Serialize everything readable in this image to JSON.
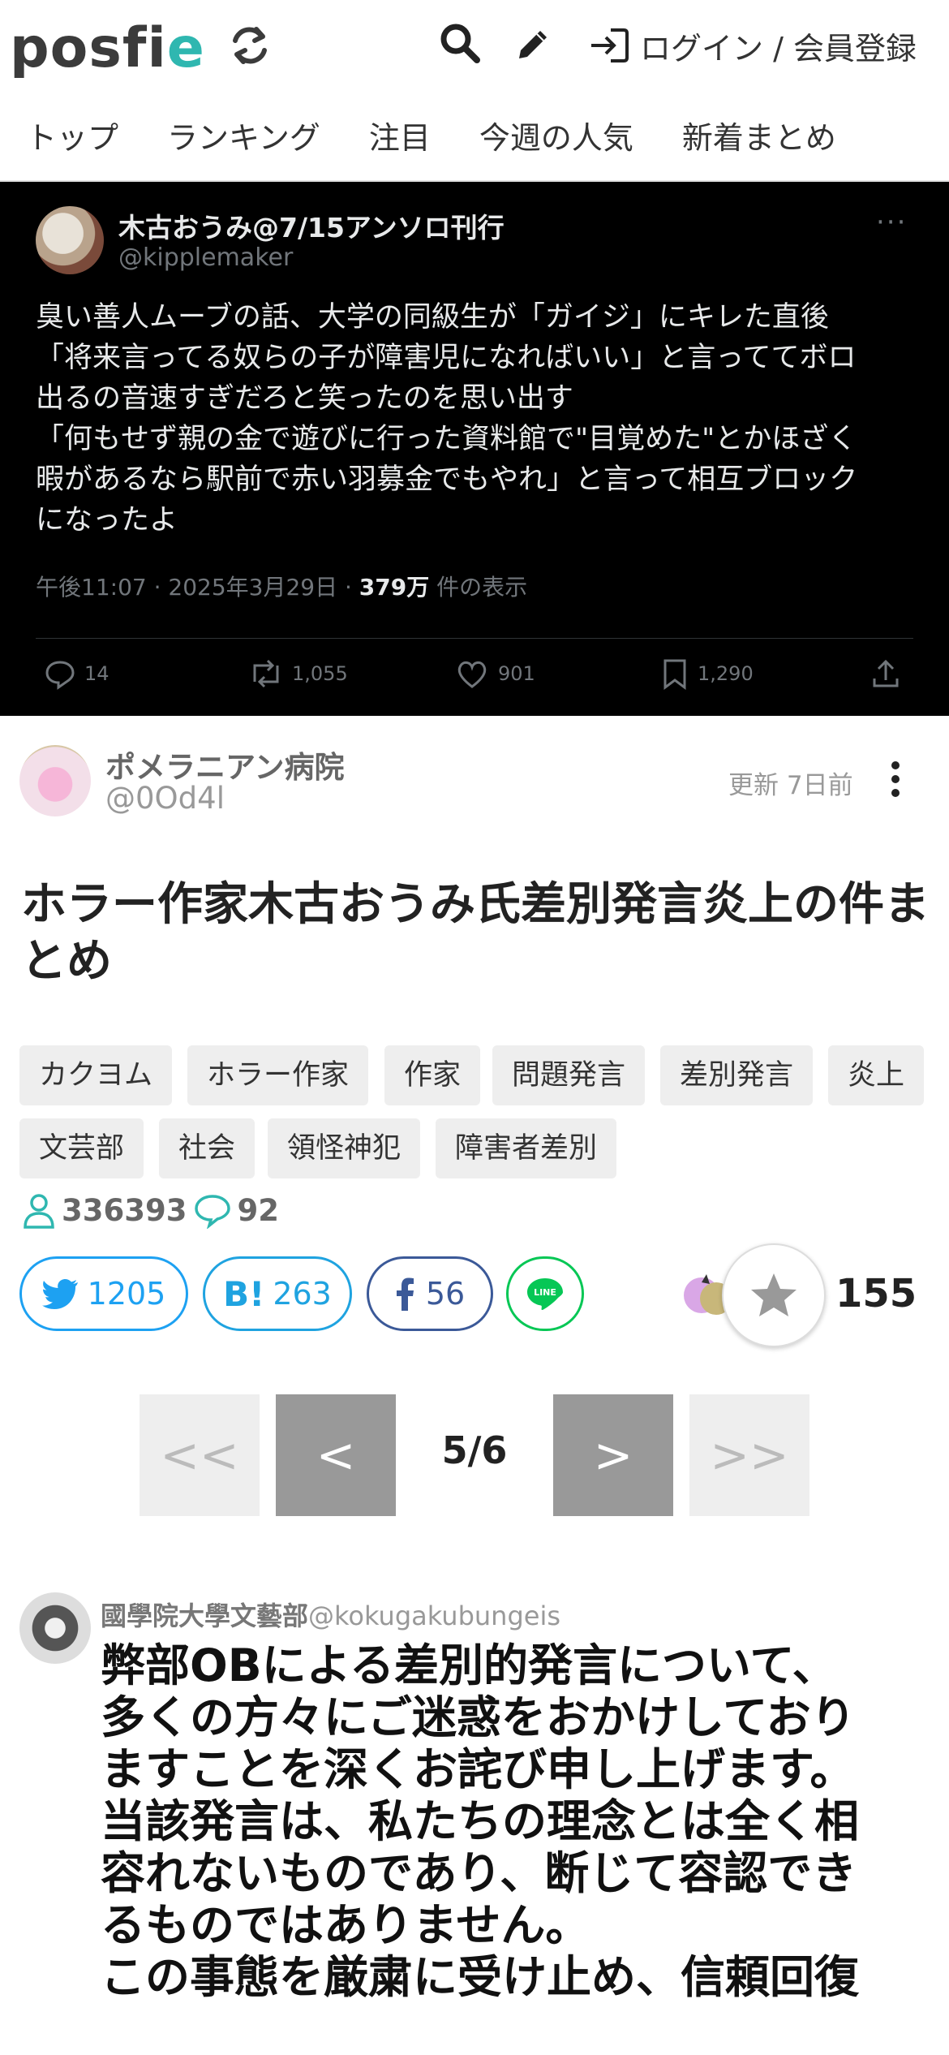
{
  "header": {
    "logo_main": "posfi",
    "logo_accent": "e",
    "login_label": "ログイン / 会員登録",
    "nav": [
      "トップ",
      "ランキング",
      "注目",
      "今週の人気",
      "新着まとめ"
    ]
  },
  "tweet": {
    "name": "木古おうみ@7/15アンソロ刊行",
    "handle": "@kipplemaker",
    "more": "···",
    "body": "臭い善人ムーブの話、大学の同級生が「ガイジ」にキレた直後\n「将来言ってる奴らの子が障害児になればいい」と言っててボロ\n出るの音速すぎだろと笑ったのを思い出す\n「何もせず親の金で遊びに行った資料館で\"目覚めた\"とかほざく\n暇があるなら駅前で赤い羽募金でもやれ」と言って相互ブロック\nになったよ",
    "time": "午後11:07 · 2025年3月29日 · ",
    "views": "379万",
    "views_suffix": " 件の表示",
    "replies": "14",
    "retweets": "1,055",
    "likes": "901",
    "bookmarks": "1,290"
  },
  "author": {
    "name": "ポメラニアン病院",
    "handle": "@0Od4l",
    "updated": "更新 7日前"
  },
  "title": "ホラー作家木古おうみ氏差別発言炎上の件まとめ",
  "tags": [
    "カクヨム",
    "ホラー作家",
    "作家",
    "問題発言",
    "差別発言",
    "炎上",
    "文芸部",
    "社会",
    "領怪神犯",
    "障害者差別"
  ],
  "stats": {
    "views": "336393",
    "comments": "92"
  },
  "share": {
    "twitter": "1205",
    "hatena": "263",
    "facebook": "56",
    "line": "LINE",
    "favorites": "155"
  },
  "pagination": {
    "label": "5/6",
    "first": "<<",
    "prev": "<",
    "next": ">",
    "last": ">>"
  },
  "item": {
    "source_name": "國學院大學文藝部",
    "source_handle": "@kokugakubungeis",
    "body": "弊部OBによる差別的発言について、\n多くの方々にご迷惑をおかけしており\nますことを深くお詫び申し上げます。\n当該発言は、私たちの理念とは全く相\n容れないものであり、断じて容認でき\nるものではありません。\nこの事態を厳粛に受け止め、信頼回復"
  }
}
